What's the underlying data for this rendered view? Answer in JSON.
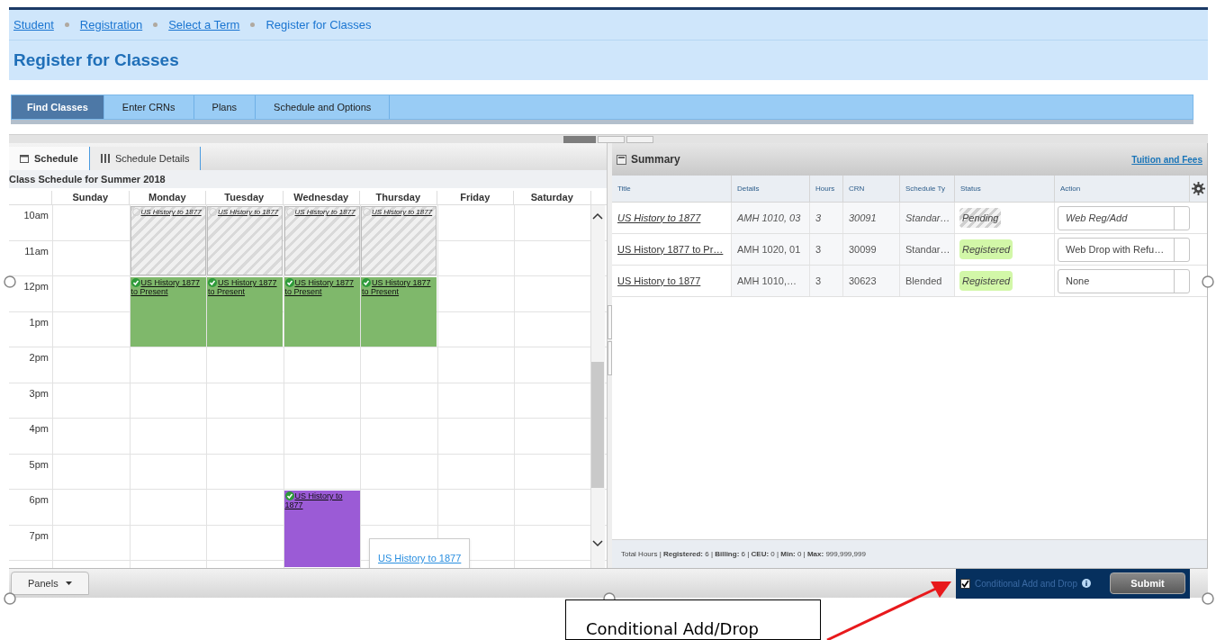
{
  "breadcrumbs": [
    {
      "label": "Student",
      "kind": "link"
    },
    {
      "label": "Registration",
      "kind": "link"
    },
    {
      "label": "Select a Term",
      "kind": "link"
    },
    {
      "label": "Register for Classes",
      "kind": "current"
    }
  ],
  "page_title": "Register for Classes",
  "tabs": [
    {
      "label": "Find Classes",
      "selected": true
    },
    {
      "label": "Enter CRNs",
      "selected": false
    },
    {
      "label": "Plans",
      "selected": false
    },
    {
      "label": "Schedule and Options",
      "selected": false
    }
  ],
  "schedule": {
    "tabs": [
      {
        "label": "Schedule",
        "selected": true
      },
      {
        "label": "Schedule Details",
        "selected": false
      }
    ],
    "heading": "Class Schedule for Summer 2018",
    "days": [
      "Sunday",
      "Monday",
      "Tuesday",
      "Wednesday",
      "Thursday",
      "Friday",
      "Saturday"
    ],
    "hours": [
      "10am",
      "11am",
      "12pm",
      "1pm",
      "2pm",
      "3pm",
      "4pm",
      "5pm",
      "6pm",
      "7pm"
    ],
    "events": [
      {
        "title": "US History to 1877",
        "kind": "pending",
        "color": "#d9d9d9"
      },
      {
        "title": "US History to 1877",
        "kind": "pending",
        "color": "#d9d9d9"
      },
      {
        "title": "US History to 1877",
        "kind": "pending",
        "color": "#d9d9d9"
      },
      {
        "title": "US History to 1877",
        "kind": "pending",
        "color": "#d9d9d9"
      },
      {
        "title": "US History 1877 to Present",
        "kind": "registered",
        "color": "#7fb86b"
      },
      {
        "title": "US History 1877 to Present",
        "kind": "registered",
        "color": "#7fb86b"
      },
      {
        "title": "US History 1877 to Present",
        "kind": "registered",
        "color": "#7fb86b"
      },
      {
        "title": "US History 1877 to Present",
        "kind": "registered",
        "color": "#7fb86b"
      },
      {
        "title": "US History to 1877",
        "kind": "registered",
        "color": "#9b5bd6"
      }
    ],
    "tooltip": "US History to 1877"
  },
  "summary": {
    "title": "Summary",
    "link": "Tuition and Fees",
    "columns": [
      "Title",
      "Details",
      "Hours",
      "CRN",
      "Schedule Ty",
      "Status",
      "Action"
    ],
    "rows": [
      {
        "title": "US History to 1877",
        "details": "AMH 1010, 03",
        "hours": "3",
        "crn": "30091",
        "schedule_type": "Standar…",
        "status": "Pending",
        "pending": true,
        "action": "Web Reg/Add"
      },
      {
        "title": "US History 1877 to Pr…",
        "details": "AMH 1020, 01",
        "hours": "3",
        "crn": "30099",
        "schedule_type": "Standar…",
        "status": "Registered",
        "pending": false,
        "action": "Web Drop with Refu…"
      },
      {
        "title": "US History to 1877",
        "details": "AMH 1010,…",
        "hours": "3",
        "crn": "30623",
        "schedule_type": "Blended",
        "status": "Registered",
        "pending": false,
        "action": "None"
      }
    ],
    "totals": "Total Hours | **Registered:** 6 | **Billing:** 6 | **CEU:** 0 | **Min:** 0 | **Max:** 999,999,999"
  },
  "bottom_bar": {
    "panels_button": "Panels",
    "conditional": {
      "label": "Conditional Add and Drop",
      "checked": true
    },
    "submit": "Submit"
  },
  "annotation": "Conditional Add/Drop"
}
